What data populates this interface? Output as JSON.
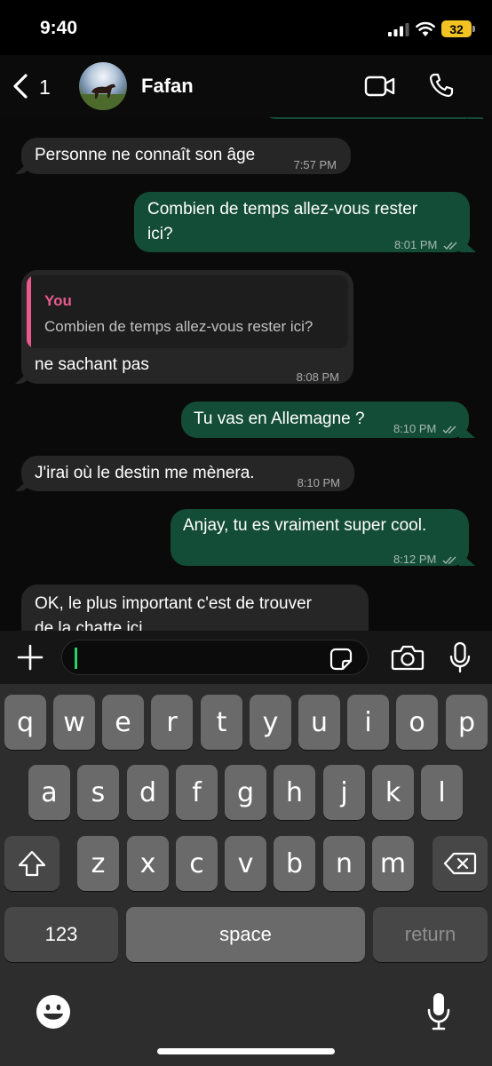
{
  "status_bar": {
    "time": "9:40",
    "battery": "32"
  },
  "header": {
    "back_count": "1",
    "contact_name": "Fafan"
  },
  "messages": [
    {
      "direction": "in",
      "text": "Personne ne connaît son âge",
      "time": "7:57 PM"
    },
    {
      "direction": "out",
      "text_line1": "Combien de temps allez-vous rester",
      "text_line2": "ici?",
      "time": "8:01 PM"
    },
    {
      "direction": "in",
      "quote_author": "You",
      "quote_text": "Combien de temps allez-vous rester ici?",
      "text": "ne sachant pas",
      "time": "8:08 PM"
    },
    {
      "direction": "out",
      "text": "Tu vas en Allemagne ?",
      "time": "8:10 PM"
    },
    {
      "direction": "in",
      "text": "J'irai où le destin me mènera.",
      "time": "8:10 PM"
    },
    {
      "direction": "out",
      "text": "Anjay, tu es vraiment super cool.",
      "time": "8:12 PM"
    },
    {
      "direction": "in",
      "text_line1": "OK, le plus important c'est de trouver",
      "text_line2": "de la chatte ici"
    }
  ],
  "composer": {
    "value": ""
  },
  "keyboard": {
    "row1": [
      "q",
      "w",
      "e",
      "r",
      "t",
      "y",
      "u",
      "i",
      "o",
      "p"
    ],
    "row2": [
      "a",
      "s",
      "d",
      "f",
      "g",
      "h",
      "j",
      "k",
      "l"
    ],
    "row3": [
      "z",
      "x",
      "c",
      "v",
      "b",
      "n",
      "m"
    ],
    "numbers_label": "123",
    "space_label": "space",
    "return_label": "return"
  },
  "icons": {
    "back": "chevron-left-icon",
    "video": "video-camera-icon",
    "phone": "phone-icon",
    "plus": "plus-icon",
    "sticker": "sticker-icon",
    "camera": "camera-icon",
    "mic": "microphone-icon",
    "shift": "shift-icon",
    "delete": "delete-icon",
    "emoji": "emoji-icon",
    "dictation": "microphone-icon"
  },
  "colors": {
    "outgoing_bubble": "#144d37",
    "incoming_bubble": "#262626",
    "quote_accent": "#ea5a8d",
    "caret": "#25d366",
    "battery": "#f2c322"
  }
}
